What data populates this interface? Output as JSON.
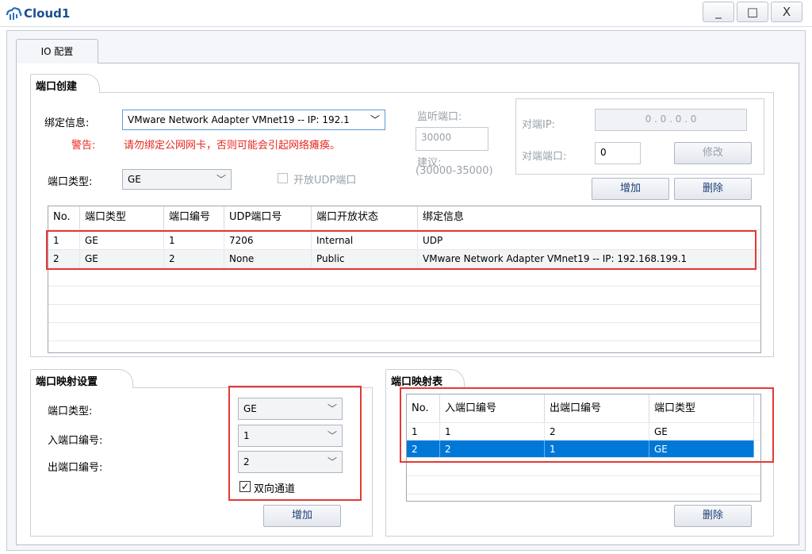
{
  "window": {
    "title": "Cloud1",
    "minimize": "_",
    "maximize": "□",
    "close": "X"
  },
  "tab": {
    "label": "IO 配置"
  },
  "port_create": {
    "section_title": "端口创建",
    "bind_label": "绑定信息:",
    "bind_value": "VMware Network Adapter VMnet19 -- IP: 192.1",
    "warning_label": "警告:",
    "warning_text": "请勿绑定公网网卡，否则可能会引起网络瘫痪。",
    "port_type_label": "端口类型:",
    "port_type_value": "GE",
    "udp_open_label": "开放UDP端口",
    "listen_port_label": "监听端口:",
    "listen_port_value": "30000",
    "suggest_label": "建议:",
    "suggest_range": "(30000-35000)",
    "peer_ip_label": "对端IP:",
    "peer_ip_value": "0  .  0  .  0  .  0",
    "peer_port_label": "对端端口:",
    "peer_port_value": "0",
    "modify_button": "修改",
    "add_button": "增加",
    "delete_button": "删除",
    "table": {
      "headers": [
        "No.",
        "端口类型",
        "端口编号",
        "UDP端口号",
        "端口开放状态",
        "绑定信息"
      ],
      "rows": [
        [
          "1",
          "GE",
          "1",
          "7206",
          "Internal",
          "UDP"
        ],
        [
          "2",
          "GE",
          "2",
          "None",
          "Public",
          "VMware Network Adapter VMnet19 -- IP: 192.168.199.1"
        ]
      ]
    }
  },
  "port_mapping": {
    "section_title": "端口映射设置",
    "type_label": "端口类型:",
    "type_value": "GE",
    "in_label": "入端口编号:",
    "in_value": "1",
    "out_label": "出端口编号:",
    "out_value": "2",
    "bidirectional_label": "双向通道",
    "bidirectional_checked": true,
    "add_button": "增加"
  },
  "mapping_table": {
    "section_title": "端口映射表",
    "headers": [
      "No.",
      "入端口编号",
      "出端口编号",
      "端口类型"
    ],
    "rows": [
      [
        "1",
        "1",
        "2",
        "GE"
      ],
      [
        "2",
        "2",
        "1",
        "GE"
      ]
    ],
    "selected_row": 2,
    "delete_button": "删除"
  },
  "colors": {
    "accent": "#0078d7",
    "highlight": "#e53935",
    "warning": "#e8281f"
  }
}
